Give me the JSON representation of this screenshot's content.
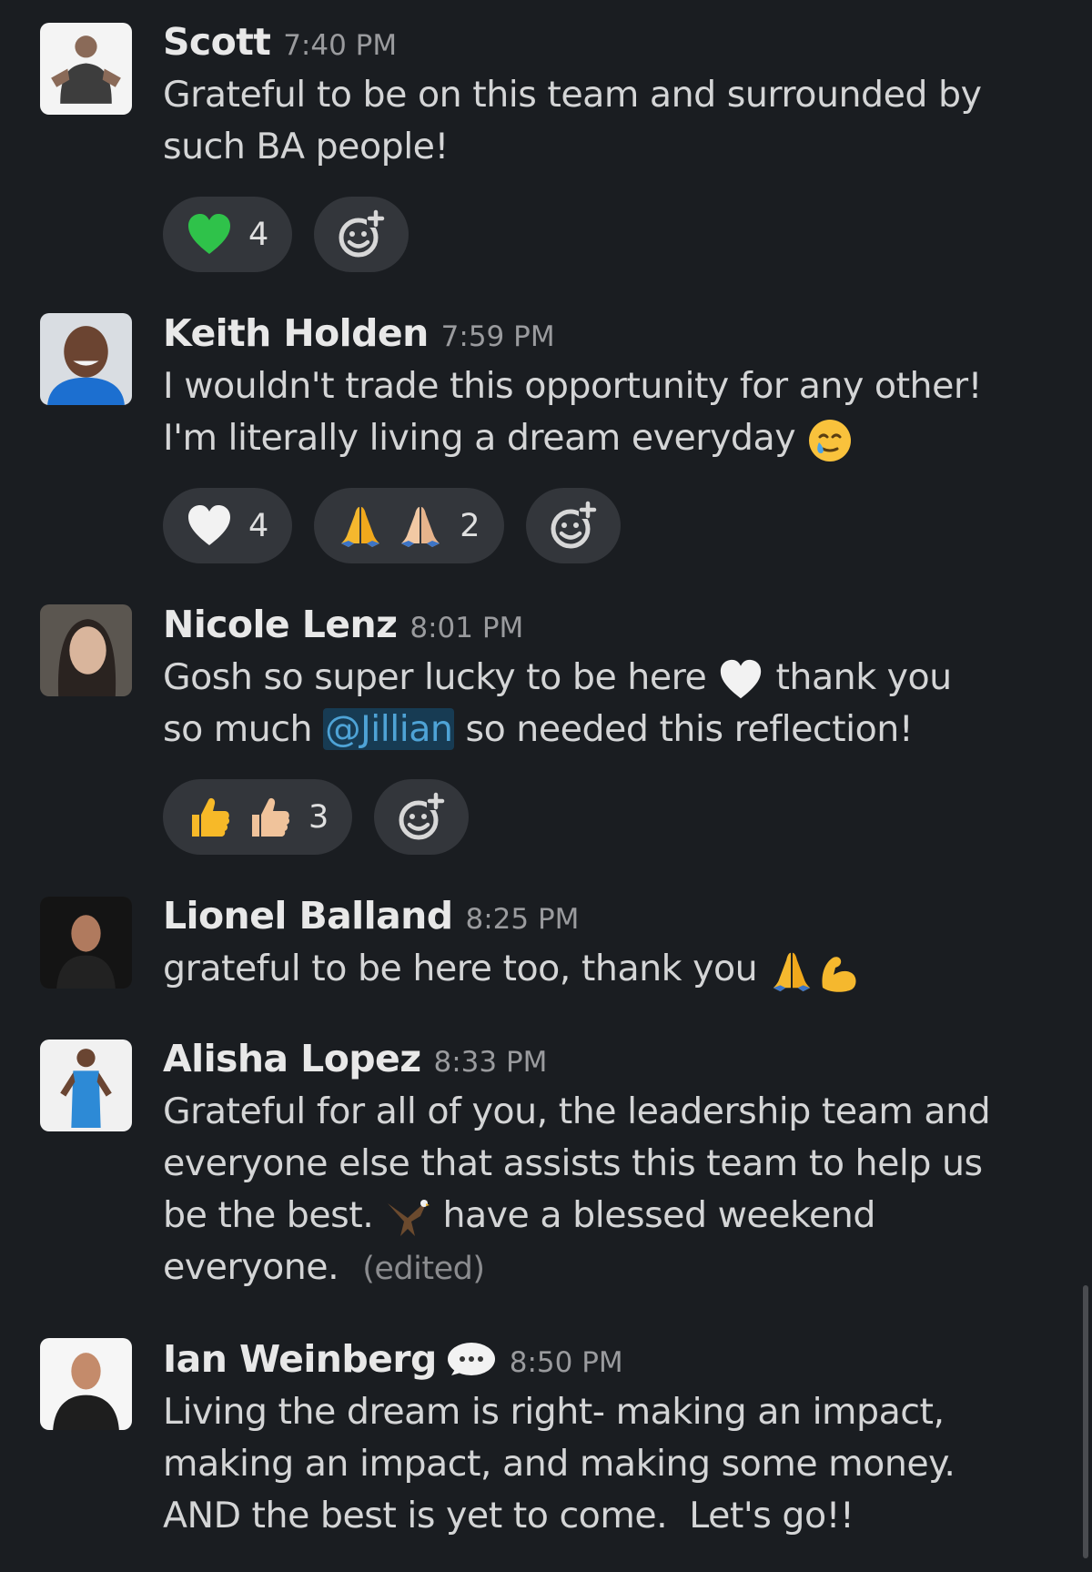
{
  "messages": [
    {
      "author": "Scott",
      "time": "7:40 PM",
      "avatar_icon": "profile-photo",
      "lines": [
        "Grateful to be on this team and surrounded by",
        "such BA people!"
      ],
      "reactions": [
        {
          "emoji": "green-heart",
          "count": "4"
        }
      ]
    },
    {
      "author": "Keith Holden",
      "time": "7:59 PM",
      "avatar_icon": "profile-photo",
      "lines": [
        "I wouldn't trade this opportunity for any other!",
        "I'm literally living a dream everyday"
      ],
      "inline_emoji": "smiling-face-with-tear",
      "reactions": [
        {
          "emoji": "white-heart",
          "count": "4"
        },
        {
          "emoji": "folded-hands",
          "count": "2"
        }
      ]
    },
    {
      "author": "Nicole Lenz",
      "time": "8:01 PM",
      "avatar_icon": "profile-photo",
      "line1_a": "Gosh so super lucky to be here",
      "line1_b": "thank you",
      "line2_a": "so much",
      "mention": "@Jillian",
      "line2_b": "so needed this reflection!",
      "inline_emoji": "white-heart",
      "reactions": [
        {
          "emoji": "thumbs-up",
          "count": "3"
        }
      ]
    },
    {
      "author": "Lionel Balland",
      "time": "8:25 PM",
      "avatar_icon": "profile-photo",
      "line1": "grateful to be here too, thank you",
      "inline_emoji": [
        "folded-hands",
        "flexed-biceps"
      ]
    },
    {
      "author": "Alisha Lopez",
      "time": "8:33 PM",
      "avatar_icon": "profile-photo",
      "line1": "Grateful for all of you, the leadership team and",
      "line2": "everyone else that assists this team to help us",
      "line3_a": "be the best.",
      "line3_b": "have a blessed weekend",
      "line4": "everyone.",
      "edited": "(edited)",
      "inline_emoji": "eagle"
    },
    {
      "author": "Ian Weinberg",
      "time": "8:50 PM",
      "avatar_icon": "profile-photo",
      "status_icon": "speech-bubble",
      "lines": [
        "Living the dream is right- making an impact,",
        "making an impact, and making some money.",
        "AND the best is yet to come.  Let's go!!"
      ]
    }
  ],
  "colors": {
    "background": "#1a1d21",
    "pill": "#33363b",
    "mention": "#4ea3d6"
  }
}
